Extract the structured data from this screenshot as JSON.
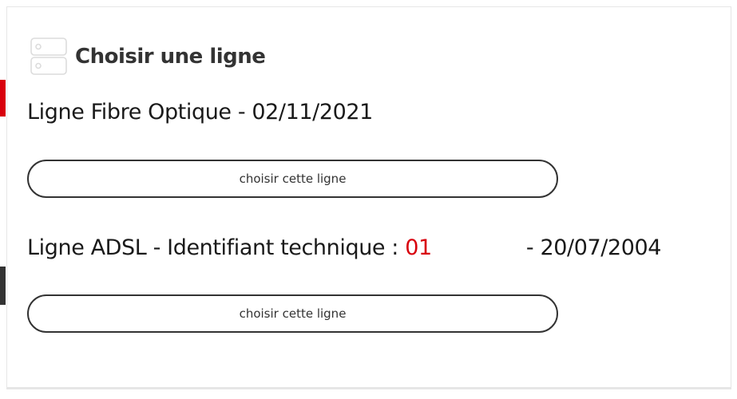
{
  "panel": {
    "title": "Choisir une ligne",
    "icon": "server-rack-icon"
  },
  "lines": [
    {
      "title": "Ligne Fibre Optique - 02/11/2021",
      "button_label": "choisir cette ligne"
    },
    {
      "title_prefix": "Ligne ADSL - Identifiant technique : ",
      "technical_id_visible": "01",
      "title_suffix": " - 20/07/2004",
      "button_label": "choisir cette ligne"
    }
  ],
  "colors": {
    "accent_red": "#d8000c",
    "text_dark": "#333333",
    "border_light": "#e6e6e6"
  }
}
